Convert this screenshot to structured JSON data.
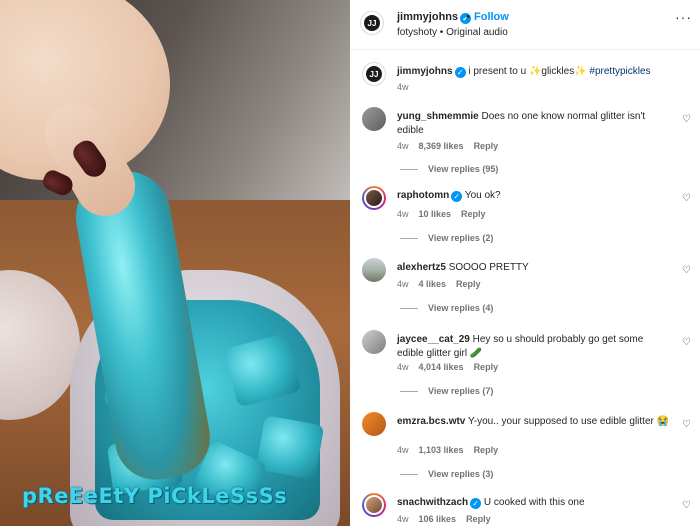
{
  "video": {
    "caption_overlay": "pReEeEtY PiCkLeSsSs"
  },
  "header": {
    "username": "jimmyjohns",
    "separator": "•",
    "follow_label": "Follow",
    "subline": "fotyshoty • Original audio",
    "avatar_text": "JJ"
  },
  "post": {
    "username": "jimmyjohns",
    "text_pre": "i present to u ✨glickles✨ ",
    "hashtag": "#prettypickles",
    "age": "4w"
  },
  "comments": [
    {
      "user": "yung_shmemmie",
      "text": "Does no one know normal glitter isn't edible",
      "age": "4w",
      "likes": "8,369 likes",
      "reply": "Reply",
      "view_replies": "View replies (95)",
      "verified": false
    },
    {
      "user": "raphotomn",
      "text": "You ok?",
      "age": "4w",
      "likes": "10 likes",
      "reply": "Reply",
      "view_replies": "View replies (2)",
      "verified": true
    },
    {
      "user": "alexhertz5",
      "text": "SOOOO PRETTY",
      "age": "4w",
      "likes": "4 likes",
      "reply": "Reply",
      "view_replies": "View replies (4)",
      "verified": false
    },
    {
      "user": "jaycee__cat_29",
      "text": "Hey so u should probably go get some edible glitter girl 🥒",
      "age": "4w",
      "likes": "4,014 likes",
      "reply": "Reply",
      "view_replies": "View replies (7)",
      "verified": false
    },
    {
      "user": "emzra.bcs.wtv",
      "text": "Y-you.. your supposed to use edible glitter 😭",
      "age": "4w",
      "likes": "1,103 likes",
      "reply": "Reply",
      "view_replies": "View replies (3)",
      "verified": false
    },
    {
      "user": "snachwithzach",
      "text": "U cooked with this one",
      "age": "4w",
      "likes": "106 likes",
      "reply": "Reply",
      "view_replies": "",
      "verified": true
    }
  ],
  "colors": {
    "accent": "#0095f6",
    "caption": "#3ed4ea"
  }
}
